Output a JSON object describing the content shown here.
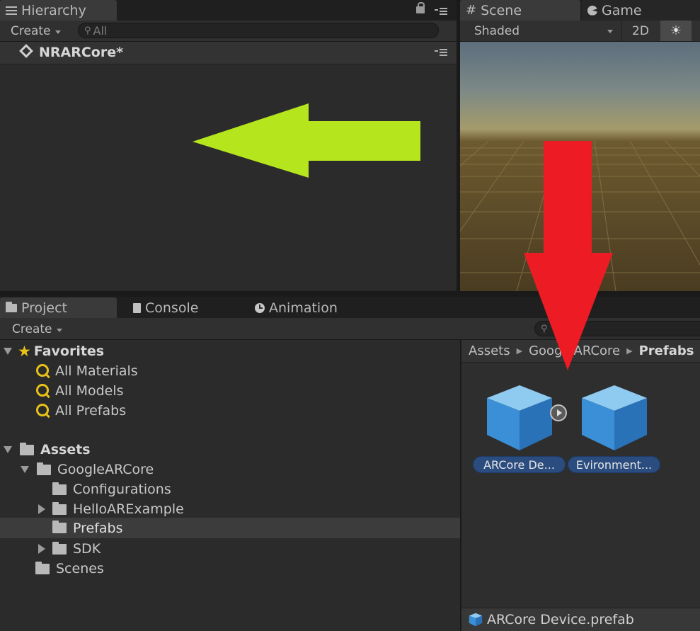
{
  "hierarchy": {
    "tab_label": "Hierarchy",
    "create_label": "Create",
    "search_placeholder": "All",
    "scene_name": "NRARCore*"
  },
  "scene": {
    "tabs": [
      {
        "label": "Scene"
      },
      {
        "label": "Game"
      }
    ],
    "shading_mode": "Shaded",
    "toggle_2d": "2D"
  },
  "project": {
    "tabs": [
      {
        "label": "Project"
      },
      {
        "label": "Console"
      },
      {
        "label": "Animation"
      }
    ],
    "create_label": "Create",
    "favorites": {
      "label": "Favorites",
      "items": [
        {
          "label": "All Materials"
        },
        {
          "label": "All Models"
        },
        {
          "label": "All Prefabs"
        }
      ]
    },
    "assets": {
      "label": "Assets",
      "tree": [
        {
          "label": "GoogleARCore"
        },
        {
          "label": "Configurations"
        },
        {
          "label": "HelloARExample"
        },
        {
          "label": "Prefabs"
        },
        {
          "label": "SDK"
        },
        {
          "label": "Scenes"
        }
      ]
    },
    "breadcrumb": [
      {
        "label": "Assets"
      },
      {
        "label": "GoogleARCore"
      },
      {
        "label": "Prefabs"
      }
    ],
    "files": [
      {
        "label": "ARCore De..."
      },
      {
        "label": "Evironment..."
      }
    ],
    "selected_file": "ARCore Device.prefab"
  },
  "colors": {
    "arrow_green": "#b5e61d",
    "arrow_red": "#ed1c24",
    "selected_pill": "#2a4c7f",
    "favorite_star": "#e8c21a"
  }
}
